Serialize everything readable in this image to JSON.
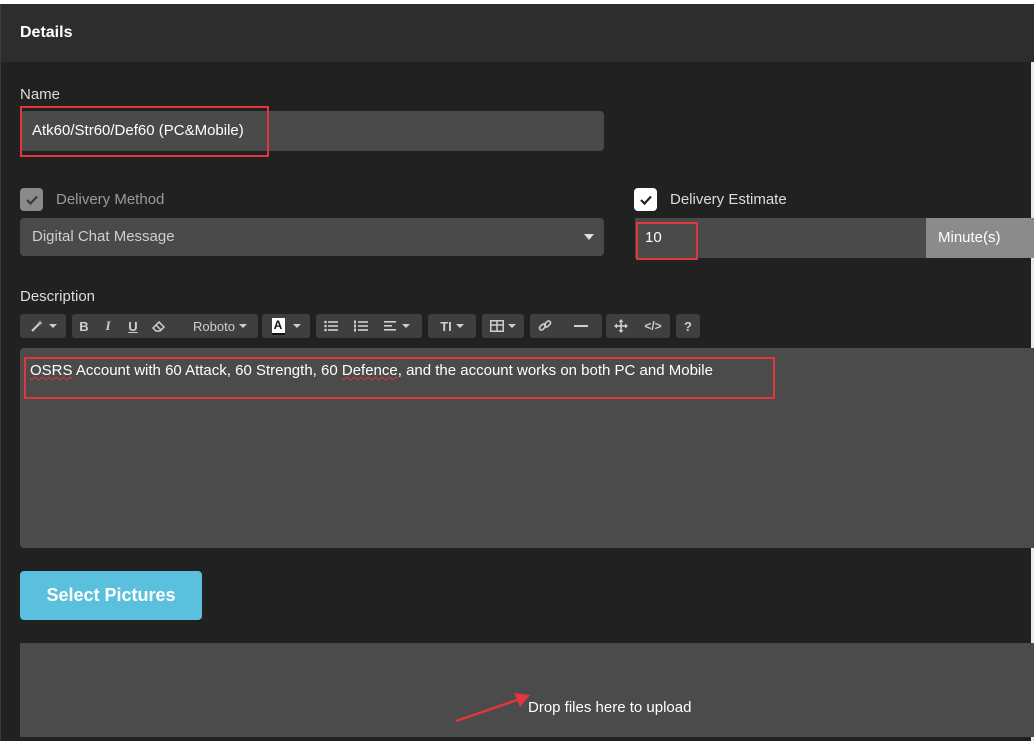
{
  "panel": {
    "title": "Details"
  },
  "name_field": {
    "label": "Name",
    "value": "Atk60/Str60/Def60 (PC&Mobile)"
  },
  "delivery_method": {
    "label": "Delivery Method",
    "checked": true,
    "selected": "Digital Chat Message"
  },
  "delivery_estimate": {
    "label": "Delivery Estimate",
    "checked": true,
    "value": "10",
    "unit": "Minute(s)"
  },
  "description": {
    "label": "Description",
    "toolbar": {
      "magic": "magic-wand-icon",
      "bold": "B",
      "italic": "I",
      "underline": "U",
      "eraser": "eraser-icon",
      "font": "Roboto",
      "color_letter": "A",
      "ul": "unordered-list-icon",
      "ol": "ordered-list-icon",
      "align": "align-icon",
      "size": "TI",
      "table": "table-icon",
      "link": "link-icon",
      "hr": "horizontal-rule-icon",
      "fullscreen": "arrows-move-icon",
      "code": "</>",
      "help": "?"
    },
    "text_parts": [
      "OSRS",
      " Account with 60 Attack, 60 Strength, 60 ",
      "Defence",
      ", and the account works on both PC and Mobile"
    ]
  },
  "upload": {
    "button_label": "Select Pictures",
    "drop_text": "Drop files here to upload"
  },
  "colors": {
    "panel": "#212121",
    "input": "#4a4a4a",
    "accent": "#5bc0de",
    "highlight": "#e0363d"
  }
}
